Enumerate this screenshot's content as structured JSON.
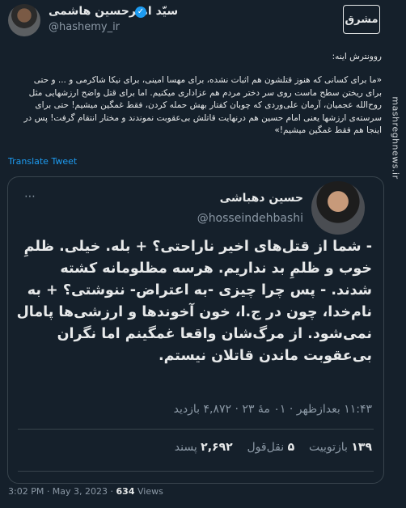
{
  "author": {
    "name": "سیّد امیرحسین هاشمی",
    "handle": "@hashemy_ir"
  },
  "logo": {
    "text": "مشرق"
  },
  "watermark": "mashreghnews.ir",
  "tweet": {
    "intro": "روونترش اینه:",
    "body": "«ما برای کسانی که هنوز قتلشون هم اثبات نشده، برای مهسا امینی، برای نیکا شاکرمی و ... و حتی برای ریختن سطح ماست روی سر دختر مردم هم عزاداری میکنیم. اما برای قتل واضح ارزشهایی مثل روح‌الله عجمیان، آرمان علی‌وردی که چوبان کفتار بهش حمله کردن، فقط غمگین میشیم! حتی برای سرسته‌ی ارزشها یعنی امام حسین هم درنهایت قاتلش بی‌عقوبت نموندند و مختار انتقام گرفت! پس در اینجا هم فقط غمگین میشیم!»",
    "translate_label": "Translate Tweet"
  },
  "quote": {
    "name": "حسین دهباشی",
    "handle": "@hosseindehbashi",
    "text": "- شما از قتل‌های اخیر ناراحتی؟ + بله. خیلی. ظلمِ خوب و ظلمِ بد نداریم. هرسه مظلومانه کشته شدند. - پس چرا چیزی -به اعتراض- ننوشتی؟ + به نام‌خدا، چون در ج.ا، خون آخوندها و ارزشی‌ها پامال نمی‌شود. از مرگ‌شان واقعا غمگینم اما نگران بی‌عقوبت ماندن قاتلان نیستم.",
    "meta": "۱۱:۴۳ بعدازظهر · ۰۱ مهٔ ۲۳ · ۴,۸۷۲ بازدید",
    "retweets_count": "۱۳۹",
    "retweets_label": "بازتوییت",
    "quotes_count": "۵",
    "quotes_label": "نقل‌قول",
    "likes_count": "۲,۶۹۲",
    "likes_label": "پسند"
  },
  "footer": {
    "time": "3:02 PM · May 3, 2023 · ",
    "views_count": "634",
    "views_label": " Views"
  }
}
